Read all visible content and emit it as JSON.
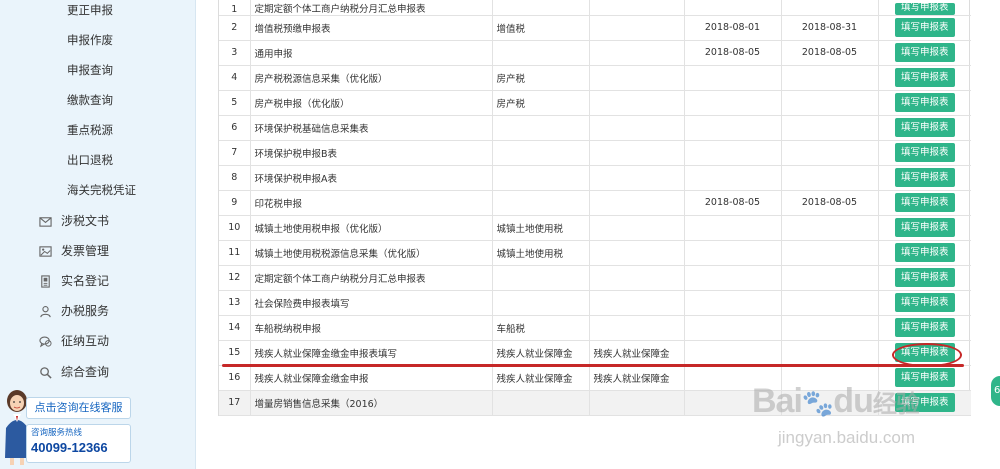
{
  "sidebar": {
    "sub_items": [
      "更正申报",
      "申报作废",
      "申报查询",
      "缴款查询",
      "重点税源",
      "出口退税",
      "海关完税凭证"
    ],
    "main_items": [
      {
        "label": "涉税文书",
        "icon": "envelope-icon"
      },
      {
        "label": "发票管理",
        "icon": "image-icon"
      },
      {
        "label": "实名登记",
        "icon": "id-card-icon"
      },
      {
        "label": "办税服务",
        "icon": "person-icon"
      },
      {
        "label": "征纳互动",
        "icon": "chat-icon"
      },
      {
        "label": "综合查询",
        "icon": "search-icon"
      }
    ],
    "consult_button": "点击咨询在线客服",
    "hotline_label": "咨询服务热线",
    "hotline_number": "40099-12366"
  },
  "table": {
    "button_label": "填写申报表",
    "rows": [
      {
        "no": "1",
        "name": "定期定额个体工商户纳税分月汇总申报表",
        "tax": "",
        "item": "",
        "start": "",
        "end": ""
      },
      {
        "no": "2",
        "name": "增值税预缴申报表",
        "tax": "增值税",
        "item": "",
        "start": "2018-08-01",
        "end": "2018-08-31"
      },
      {
        "no": "3",
        "name": "通用申报",
        "tax": "",
        "item": "",
        "start": "2018-08-05",
        "end": "2018-08-05"
      },
      {
        "no": "4",
        "name": "房产税税源信息采集（优化版）",
        "tax": "房产税",
        "item": "",
        "start": "",
        "end": ""
      },
      {
        "no": "5",
        "name": "房产税申报（优化版）",
        "tax": "房产税",
        "item": "",
        "start": "",
        "end": ""
      },
      {
        "no": "6",
        "name": "环境保护税基础信息采集表",
        "tax": "",
        "item": "",
        "start": "",
        "end": ""
      },
      {
        "no": "7",
        "name": "环境保护税申报B表",
        "tax": "",
        "item": "",
        "start": "",
        "end": ""
      },
      {
        "no": "8",
        "name": "环境保护税申报A表",
        "tax": "",
        "item": "",
        "start": "",
        "end": ""
      },
      {
        "no": "9",
        "name": "印花税申报",
        "tax": "",
        "item": "",
        "start": "2018-08-05",
        "end": "2018-08-05"
      },
      {
        "no": "10",
        "name": "城镇土地使用税申报（优化版）",
        "tax": "城镇土地使用税",
        "item": "",
        "start": "",
        "end": ""
      },
      {
        "no": "11",
        "name": "城镇土地使用税税源信息采集（优化版）",
        "tax": "城镇土地使用税",
        "item": "",
        "start": "",
        "end": ""
      },
      {
        "no": "12",
        "name": "定期定额个体工商户纳税分月汇总申报表",
        "tax": "",
        "item": "",
        "start": "",
        "end": ""
      },
      {
        "no": "13",
        "name": "社会保险费申报表填写",
        "tax": "",
        "item": "",
        "start": "",
        "end": ""
      },
      {
        "no": "14",
        "name": "车船税纳税申报",
        "tax": "车船税",
        "item": "",
        "start": "",
        "end": ""
      },
      {
        "no": "15",
        "name": "残疾人就业保障金缴金申报表填写",
        "tax": "残疾人就业保障金",
        "item": "残疾人就业保障金",
        "start": "",
        "end": ""
      },
      {
        "no": "16",
        "name": "残疾人就业保障金缴金申报",
        "tax": "残疾人就业保障金",
        "item": "残疾人就业保障金",
        "start": "",
        "end": ""
      },
      {
        "no": "17",
        "name": "增量房销售信息采集（2016）",
        "tax": "",
        "item": "",
        "start": "",
        "end": ""
      }
    ]
  },
  "watermark": {
    "logo": "Bai",
    "logo_end": "du",
    "logo_cn": "经验",
    "url": "jingyan.baidu.com"
  },
  "edge_float_label": "6"
}
